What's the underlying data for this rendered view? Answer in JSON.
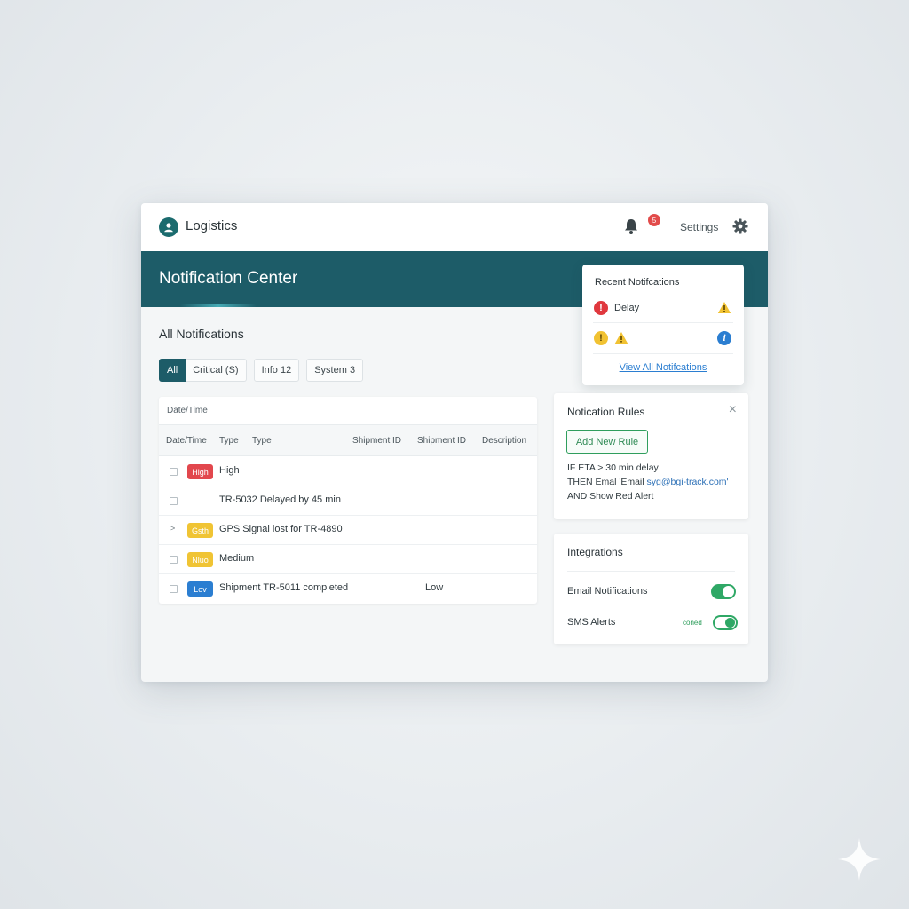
{
  "app": {
    "name": "Logistics",
    "badge_count": "5",
    "settings_label": "Settings"
  },
  "banner": {
    "title": "Notification Center"
  },
  "section": {
    "title": "All Notifications"
  },
  "filters": [
    {
      "label": "All",
      "active": true
    },
    {
      "label": "Critical (S)"
    },
    {
      "label": "Info 12"
    },
    {
      "label": "System 3"
    }
  ],
  "table": {
    "caption": "Date/Time",
    "headers": [
      "Date/Time",
      "Type",
      "Type",
      "Shipment ID",
      "Shipment ID",
      "Description"
    ],
    "rows": [
      {
        "control": "checkbox",
        "pill": "High",
        "pill_color": "#e2474d",
        "text": "High",
        "extra": ""
      },
      {
        "control": "checkbox",
        "pill": "",
        "pill_color": "",
        "text": "TR-5032 Delayed by 45 min",
        "extra": ""
      },
      {
        "control": "caret",
        "caret": "˃",
        "pill": "Gsth",
        "pill_color": "#f0c434",
        "text": "GPS Signal lost for TR-4890",
        "extra": ""
      },
      {
        "control": "checkbox",
        "pill": "Nluo",
        "pill_color": "#f0c434",
        "text": "Medium",
        "extra": ""
      },
      {
        "control": "checkbox",
        "pill": "Lov",
        "pill_color": "#2b7ed1",
        "text": "Shipment TR-5011 completed",
        "extra": "Low"
      }
    ]
  },
  "recent": {
    "title": "Recent Notifcations",
    "item1_label": "Delay",
    "link": "View All Notifcations"
  },
  "rules": {
    "title": "Notication Rules",
    "add_button": "Add New Rule",
    "line1": "IF ETA > 30 min delay",
    "line2_prefix": "THEN Emal 'Email ",
    "line2_email": "syg@bgi-track.com'",
    "line3": "AND Show Red Alert"
  },
  "integrations": {
    "title": "Integrations",
    "items": [
      {
        "label": "Email Notifications",
        "state": "on"
      },
      {
        "label": "SMS Alerts",
        "state": "on",
        "note": "coned"
      }
    ]
  },
  "colors": {
    "brand": "#1d5c68",
    "critical": "#e2474d",
    "warning": "#f0c434",
    "info": "#2b7ed1",
    "success": "#2fa866"
  }
}
